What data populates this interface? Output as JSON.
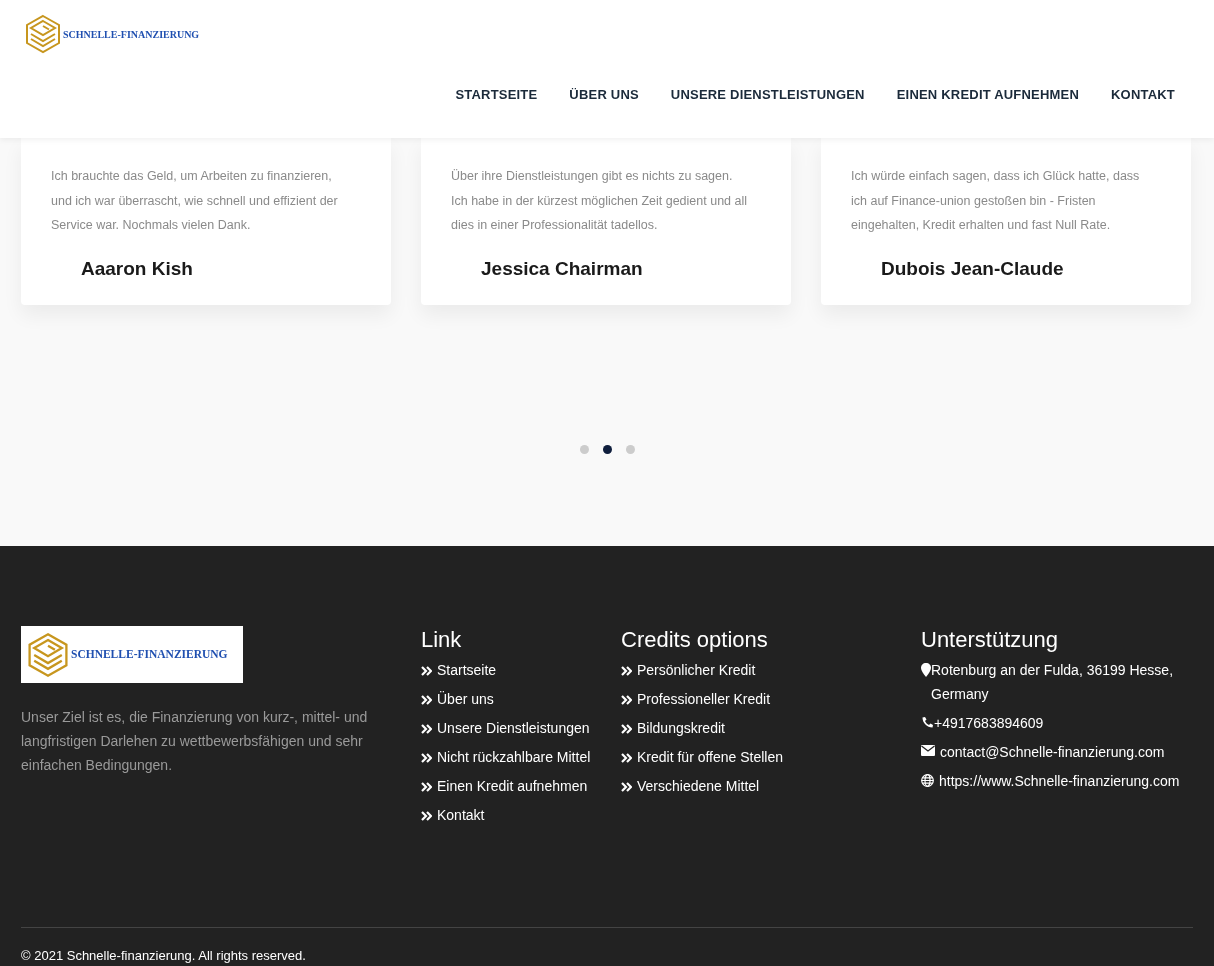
{
  "header": {
    "logo_text": "SCHNELLE-FINANZIERUNG",
    "nav": [
      "STARTSEITE",
      "ÜBER UNS",
      "UNSERE DIENSTLEISTUNGEN",
      "EINEN KREDIT AUFNEHMEN",
      "KONTAKT"
    ]
  },
  "testimonials": [
    {
      "quote": "Ich brauchte das Geld, um Arbeiten zu finanzieren, und ich war überrascht, wie schnell und effizient der Service war. Nochmals vielen Dank.",
      "name": "Aaaron Kish"
    },
    {
      "quote": "Über ihre Dienstleistungen gibt es nichts zu sagen. Ich habe in der kürzest möglichen Zeit gedient und all dies in einer Professionalität tadellos.",
      "name": "Jessica Chairman"
    },
    {
      "quote": "Ich würde einfach sagen, dass ich Glück hatte, dass ich auf Finance-union gestoßen bin - Fristen eingehalten, Kredit erhalten und fast Null Rate.",
      "name": "Dubois Jean-Claude"
    }
  ],
  "carousel_dots": [
    {
      "selected": false
    },
    {
      "selected": true
    },
    {
      "selected": false
    }
  ],
  "footer": {
    "logo_text": "SCHNELLE-FINANZIERUNG",
    "about": "Unser Ziel ist es, die Finanzierung von kurz-, mittel- und langfristigen Darlehen zu wettbewerbsfähigen und sehr einfachen Bedingungen.",
    "link_title": "Link",
    "links": [
      "Startseite",
      "Über uns",
      "Unsere Dienstleistungen",
      "Nicht rückzahlbare Mittel",
      "Einen Kredit aufnehmen",
      "Kontakt"
    ],
    "credits_title": "Credits options",
    "credits": [
      "Persönlicher Kredit",
      "Professioneller Kredit",
      "Bildungskredit",
      "Kredit für offene Stellen",
      "Verschiedene Mittel"
    ],
    "support_title": "Unterstützung",
    "support": [
      {
        "kind": "location",
        "text": "Rotenburg an der Fulda, 36199 Hesse, Germany"
      },
      {
        "kind": "phone",
        "text": "+4917683894609"
      },
      {
        "kind": "email",
        "text": "contact@Schnelle-finanzierung.com"
      },
      {
        "kind": "web",
        "text": "https://www.Schnelle-finanzierung.com"
      }
    ],
    "copyright": "© 2021 Schnelle-finanzierung. All rights reserved."
  }
}
